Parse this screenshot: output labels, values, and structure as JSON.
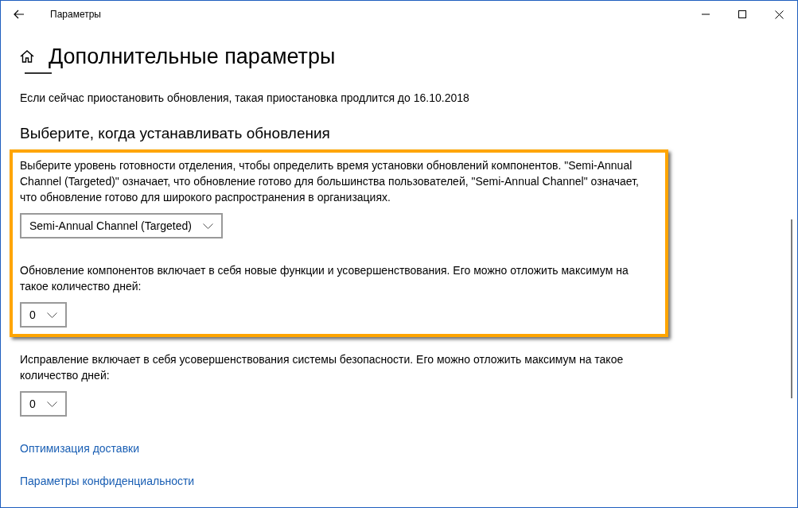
{
  "window": {
    "title": "Параметры"
  },
  "page": {
    "title": "Дополнительные параметры"
  },
  "pause_note": "Если сейчас приостановить обновления, такая приостановка продлится до 16.10.2018",
  "section": {
    "title": "Выберите, когда устанавливать обновления"
  },
  "highlighted_group": [
    {
      "kind": "text",
      "text": "Выберите уровень готовности отделения, чтобы определить время установки обновлений компонентов. \"Semi-Annual Channel (Targeted)\" означает, что обновление готово для большинства пользователей, \"Semi-Annual Channel\" означает, что обновление готово для широкого распространения в организациях."
    },
    {
      "kind": "dropdown",
      "value": "Semi-Annual Channel (Targeted)"
    },
    {
      "kind": "text",
      "text": "Обновление компонентов включает в себя новые функции и усовершенствования. Его можно отложить максимум на такое количество дней:"
    },
    {
      "kind": "dropdown",
      "value": "0"
    }
  ],
  "settings": [
    {
      "kind": "text",
      "text": "Исправление включает в себя усовершенствования системы безопасности. Его можно отложить максимум на такое количество дней:"
    },
    {
      "kind": "dropdown",
      "value": "0"
    }
  ],
  "links": [
    "Оптимизация доставки",
    "Параметры конфиденциальности"
  ]
}
